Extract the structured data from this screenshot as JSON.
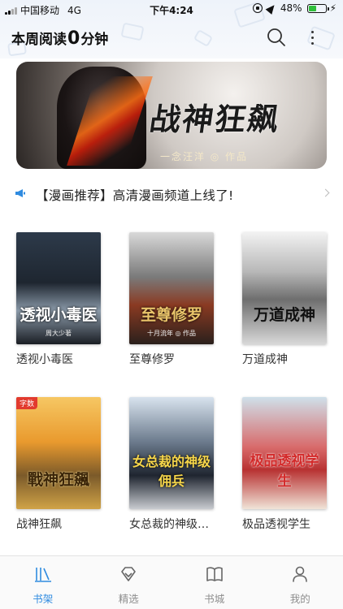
{
  "status_bar": {
    "carrier": "中国移动",
    "network": "4G",
    "time": "下午4:24",
    "battery": "48%",
    "battery_level": 0.48
  },
  "header": {
    "title_prefix": "本周阅读",
    "reading_number": "0",
    "title_suffix": "分钟"
  },
  "banner": {
    "title": "战神狂飙",
    "author_line": "一念汪洋 ◎ 作品"
  },
  "notice": {
    "text": "【漫画推荐】高清漫画频道上线了!"
  },
  "books": [
    {
      "title": "透视小毒医",
      "cover_text": "透视小毒医",
      "cover_author": "周大少著",
      "tag": ""
    },
    {
      "title": "至尊修罗",
      "cover_text": "至尊修罗",
      "cover_author": "十月流年 ◎ 作品",
      "tag": ""
    },
    {
      "title": "万道成神",
      "cover_text": "万道成神",
      "cover_author": "",
      "tag": ""
    },
    {
      "title": "战神狂飙",
      "cover_text": "戰神狂飆",
      "cover_author": "",
      "tag": "字数"
    },
    {
      "title": "女总裁的神级…",
      "cover_text": "女总裁的神级佣兵",
      "cover_author": "",
      "tag": ""
    },
    {
      "title": "极品透视学生",
      "cover_text": "极品透视学生",
      "cover_author": "",
      "tag": ""
    }
  ],
  "tabs": [
    {
      "label": "书架",
      "icon": "bookshelf-icon",
      "active": true
    },
    {
      "label": "精选",
      "icon": "diamond-icon",
      "active": false
    },
    {
      "label": "书城",
      "icon": "open-book-icon",
      "active": false
    },
    {
      "label": "我的",
      "icon": "person-icon",
      "active": false
    }
  ],
  "colors": {
    "accent": "#2f8be0",
    "inactive": "#8e8e8e",
    "notice_icon": "#2f8be0"
  }
}
